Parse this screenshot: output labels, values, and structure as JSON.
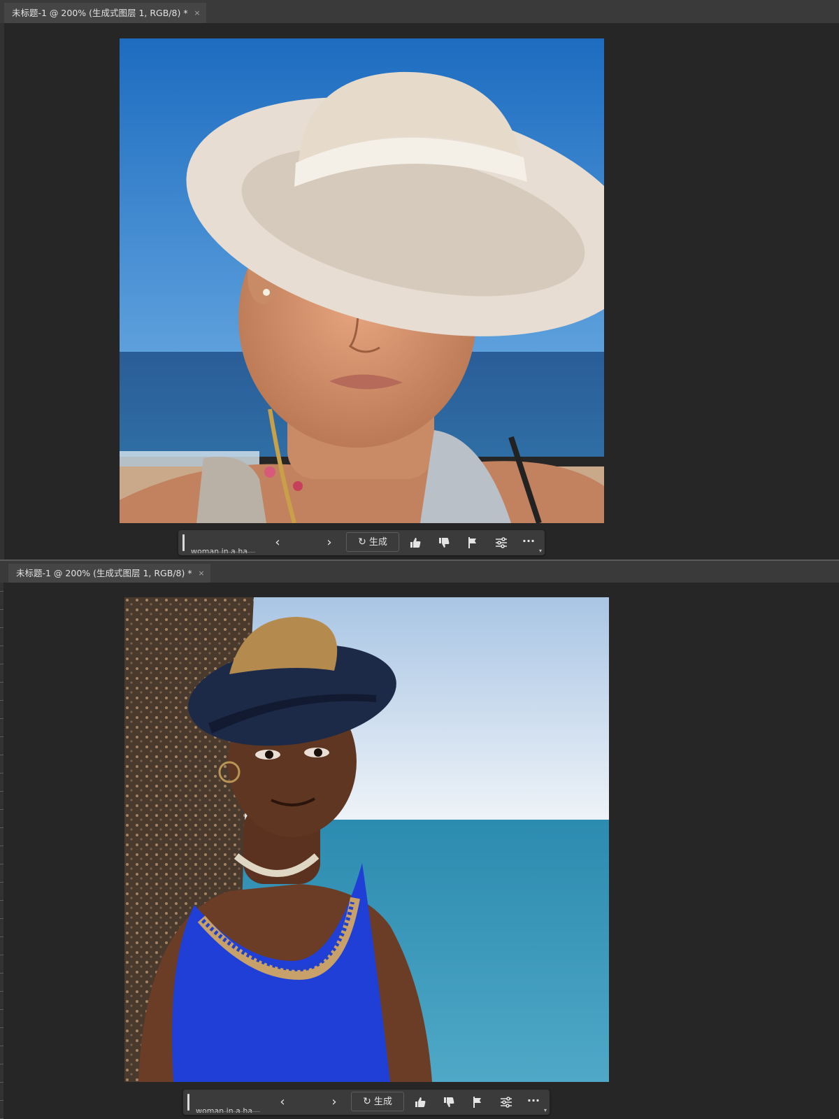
{
  "panels": [
    {
      "tab": {
        "title": "未标题-1 @ 200% (生成式图层 1, RGB/8) *",
        "close": "×"
      },
      "image_subject": "woman-in-white-sun-hat-beach",
      "genbar": {
        "prompt": "woman in a ha",
        "prev": "‹",
        "next": "›",
        "generate_label": "生成",
        "generate_icon": "↻",
        "more": "···"
      }
    },
    {
      "tab": {
        "title": "未标题-1 @ 200% (生成式图层 1, RGB/8) *",
        "close": "×"
      },
      "image_subject": "woman-in-blue-hat-by-sea",
      "genbar": {
        "prompt": "woman in a ha",
        "prev": "‹",
        "next": "›",
        "generate_label": "生成",
        "generate_icon": "↻",
        "more": "···"
      }
    }
  ],
  "colors": {
    "app_bg": "#262626",
    "tabbar_bg": "#3a3a3a",
    "tab_bg": "#454545",
    "genbar_bg": "#3b3b3b"
  },
  "icons": [
    "refresh-icon",
    "thumbs-up-icon",
    "thumbs-down-icon",
    "flag-icon",
    "sliders-icon",
    "more-icon",
    "close-icon",
    "chevron-left-icon",
    "chevron-right-icon"
  ]
}
